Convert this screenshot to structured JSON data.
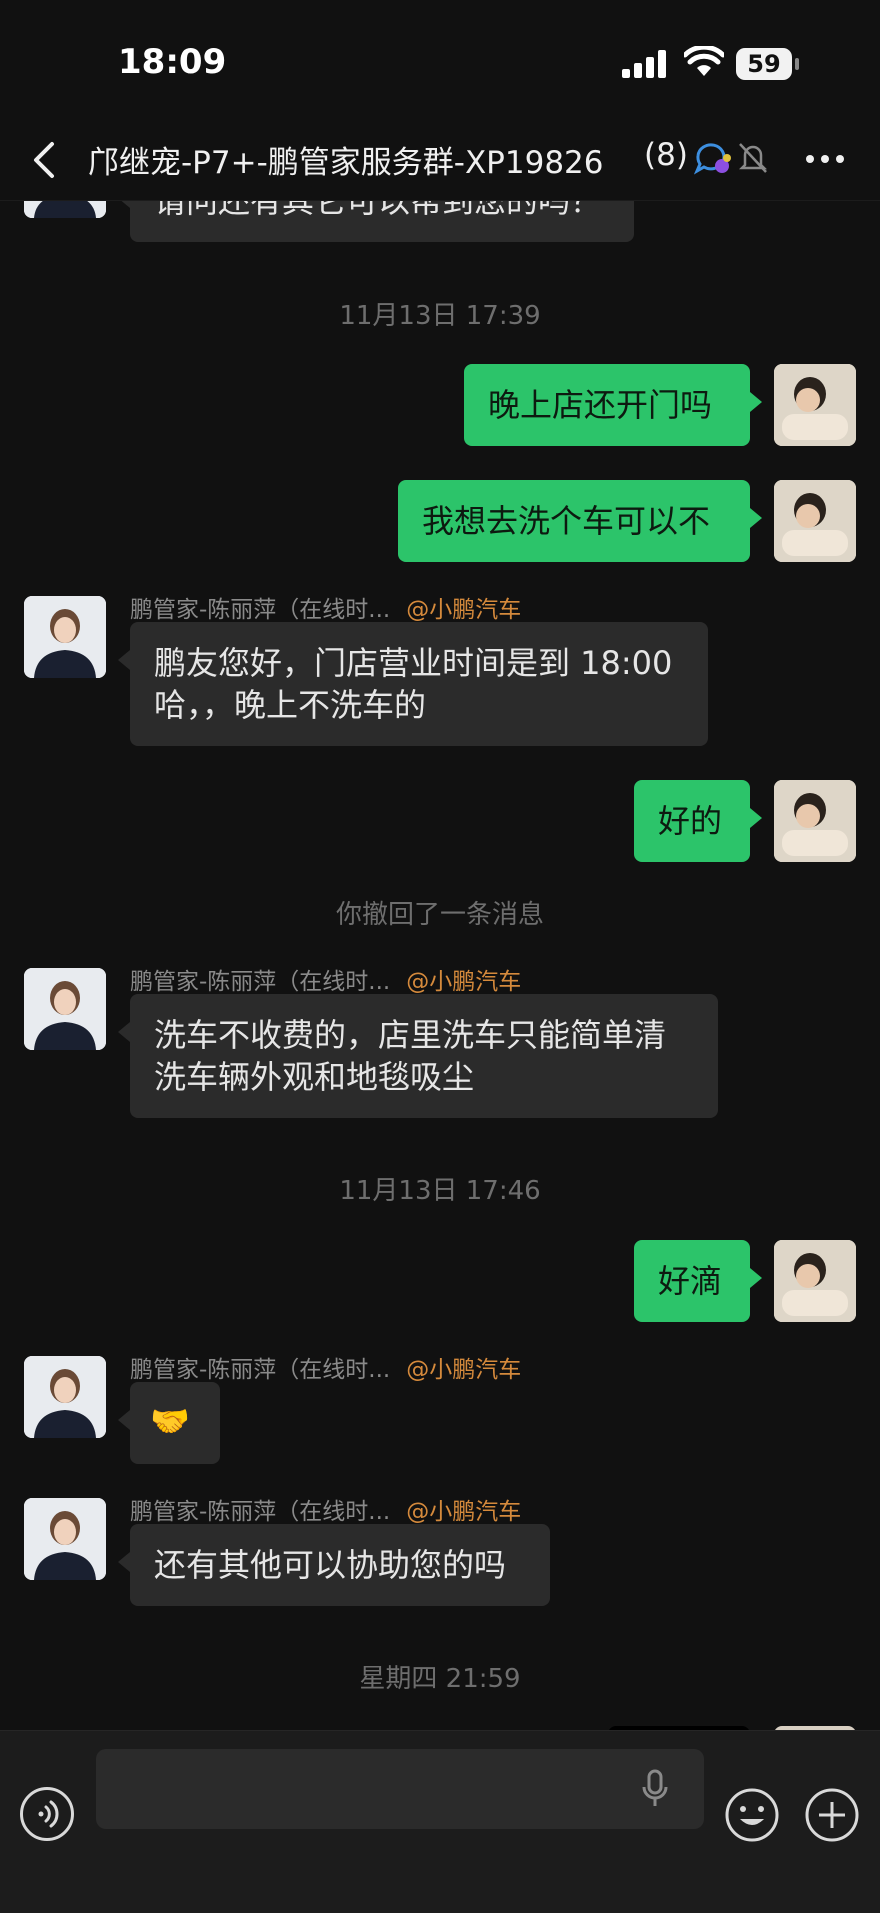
{
  "status": {
    "time": "18:09",
    "battery": "59"
  },
  "header": {
    "title": "邝继宠-P7+-鹏管家服务群-XP19826",
    "member_count": "(8)"
  },
  "messages": {
    "top_cut": "请问还有其它可以帮到您的吗？",
    "sep1": "11月13日 17:39",
    "m1": "晚上店还开门吗",
    "m2": "我想去洗个车可以不",
    "agent_name": "鹏管家-陈丽萍（在线时...",
    "agent_tag": "@小鹏汽车",
    "a1_line1": "鹏友您好，门店营业时间是到 18:00",
    "a1_line2": "哈，，晚上不洗车的",
    "m3": "好的",
    "recall": "你撤回了一条消息",
    "a2_line1": "洗车不收费的，店里洗车只能简单清",
    "a2_line2": "洗车辆外观和地毯吸尘",
    "sep2": "11月13日 17:46",
    "m4": "好滴",
    "a3": "🤝",
    "a4": "还有其他可以协助您的吗",
    "sep3": "星期四 21:59"
  },
  "input": {
    "placeholder": ""
  },
  "colors": {
    "bubble_me": "#2cc46a",
    "bubble_agent": "#2b2b2b",
    "agent_tag": "#d58a3c",
    "background": "#111111"
  },
  "icons": [
    "back-icon",
    "chat-bubbles-icon",
    "bell-muted-icon",
    "more-icon",
    "voice-icon",
    "microphone-icon",
    "emoji-icon",
    "plus-icon"
  ]
}
